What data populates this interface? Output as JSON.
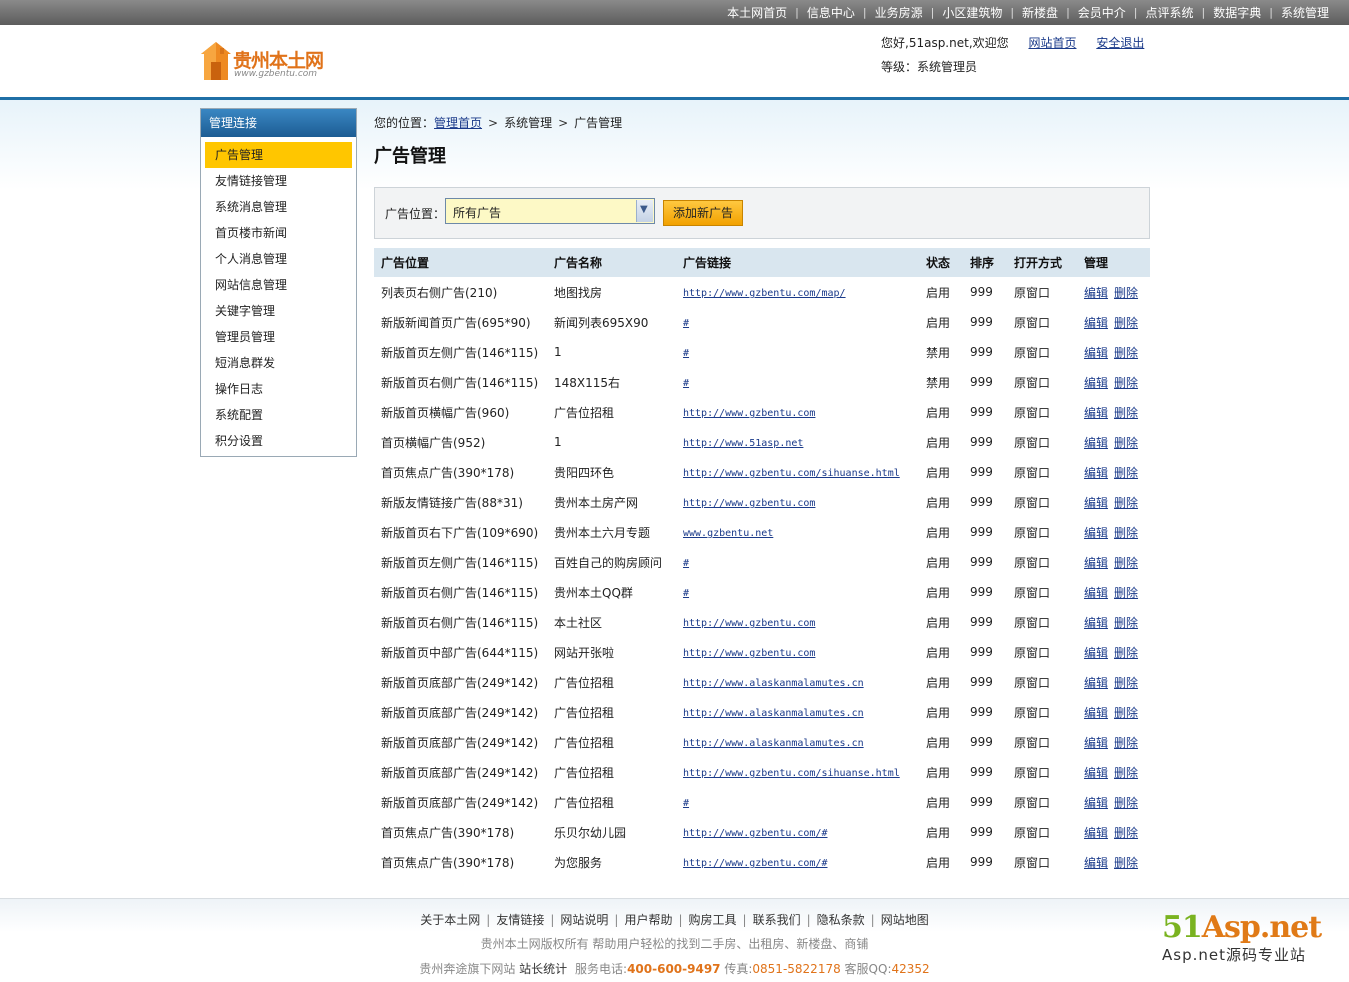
{
  "topnav": [
    "本土网首页",
    "信息中心",
    "业务房源",
    "小区建筑物",
    "新楼盘",
    "会员中介",
    "点评系统",
    "数据字典",
    "系统管理"
  ],
  "logo": {
    "name": "贵州本土网",
    "sub": "www.gzbentu.com"
  },
  "user": {
    "greeting": "您好,51asp.net,欢迎您",
    "home_link": "网站首页",
    "logout_link": "安全退出",
    "level": "等级：系统管理员"
  },
  "sidebar": {
    "title": "管理连接",
    "items": [
      "广告管理",
      "友情链接管理",
      "系统消息管理",
      "首页楼市新闻",
      "个人消息管理",
      "网站信息管理",
      "关键字管理",
      "管理员管理",
      "短消息群发",
      "操作日志",
      "系统配置",
      "积分设置"
    ]
  },
  "breadcrumb": {
    "prefix": "您的位置：",
    "home": "管理首页",
    "level1": "系统管理",
    "current": "广告管理"
  },
  "page_title": "广告管理",
  "filter": {
    "label": "广告位置：",
    "selected": "所有广告",
    "add_button": "添加新广告"
  },
  "table": {
    "headers": [
      "广告位置",
      "广告名称",
      "广告链接",
      "状态",
      "排序",
      "打开方式",
      "管理"
    ],
    "edit_label": "编辑",
    "delete_label": "删除",
    "rows": [
      {
        "pos": "列表页右侧广告(210)",
        "name": "地图找房",
        "link": "http://www.gzbentu.com/map/",
        "status": "启用",
        "order": "999",
        "open": "原窗口"
      },
      {
        "pos": "新版新闻首页广告(695*90)",
        "name": "新闻列表695X90",
        "link": "#",
        "status": "启用",
        "order": "999",
        "open": "原窗口"
      },
      {
        "pos": "新版首页左侧广告(146*115)",
        "name": "1",
        "link": "#",
        "status": "禁用",
        "order": "999",
        "open": "原窗口"
      },
      {
        "pos": "新版首页右侧广告(146*115)",
        "name": "148X115右",
        "link": "#",
        "status": "禁用",
        "order": "999",
        "open": "原窗口"
      },
      {
        "pos": "新版首页横幅广告(960)",
        "name": "广告位招租",
        "link": "http://www.gzbentu.com",
        "status": "启用",
        "order": "999",
        "open": "原窗口"
      },
      {
        "pos": "首页横幅广告(952)",
        "name": "1",
        "link": "http://www.51asp.net",
        "status": "启用",
        "order": "999",
        "open": "原窗口"
      },
      {
        "pos": "首页焦点广告(390*178)",
        "name": "贵阳四环色",
        "link": "http://www.gzbentu.com/sihuanse.html",
        "status": "启用",
        "order": "999",
        "open": "原窗口"
      },
      {
        "pos": "新版友情链接广告(88*31)",
        "name": "贵州本土房产网",
        "link": "http://www.gzbentu.com",
        "status": "启用",
        "order": "999",
        "open": "原窗口"
      },
      {
        "pos": "新版首页右下广告(109*690)",
        "name": "贵州本土六月专题",
        "link": "www.gzbentu.net",
        "status": "启用",
        "order": "999",
        "open": "原窗口"
      },
      {
        "pos": "新版首页左侧广告(146*115)",
        "name": "百姓自己的购房顾问",
        "link": "#",
        "status": "启用",
        "order": "999",
        "open": "原窗口"
      },
      {
        "pos": "新版首页右侧广告(146*115)",
        "name": "贵州本土QQ群",
        "link": "#",
        "status": "启用",
        "order": "999",
        "open": "原窗口"
      },
      {
        "pos": "新版首页右侧广告(146*115)",
        "name": "本土社区",
        "link": "http://www.gzbentu.com",
        "status": "启用",
        "order": "999",
        "open": "原窗口"
      },
      {
        "pos": "新版首页中部广告(644*115)",
        "name": "网站开张啦",
        "link": "http://www.gzbentu.com",
        "status": "启用",
        "order": "999",
        "open": "原窗口"
      },
      {
        "pos": "新版首页底部广告(249*142)",
        "name": "广告位招租",
        "link": "http://www.alaskanmalamutes.cn",
        "status": "启用",
        "order": "999",
        "open": "原窗口"
      },
      {
        "pos": "新版首页底部广告(249*142)",
        "name": "广告位招租",
        "link": "http://www.alaskanmalamutes.cn",
        "status": "启用",
        "order": "999",
        "open": "原窗口"
      },
      {
        "pos": "新版首页底部广告(249*142)",
        "name": "广告位招租",
        "link": "http://www.alaskanmalamutes.cn",
        "status": "启用",
        "order": "999",
        "open": "原窗口"
      },
      {
        "pos": "新版首页底部广告(249*142)",
        "name": "广告位招租",
        "link": "http://www.gzbentu.com/sihuanse.html",
        "status": "启用",
        "order": "999",
        "open": "原窗口"
      },
      {
        "pos": "新版首页底部广告(249*142)",
        "name": "广告位招租",
        "link": "#",
        "status": "启用",
        "order": "999",
        "open": "原窗口"
      },
      {
        "pos": "首页焦点广告(390*178)",
        "name": "乐贝尔幼儿园",
        "link": "http://www.gzbentu.com/#",
        "status": "启用",
        "order": "999",
        "open": "原窗口"
      },
      {
        "pos": "首页焦点广告(390*178)",
        "name": "为您服务",
        "link": "http://www.gzbentu.com/#",
        "status": "启用",
        "order": "999",
        "open": "原窗口"
      }
    ]
  },
  "footer": {
    "links": [
      "关于本土网",
      "友情链接",
      "网站说明",
      "用户帮助",
      "购房工具",
      "联系我们",
      "隐私条款",
      "网站地图"
    ],
    "copyright": "贵州本土网版权所有  帮助用户轻松的找到二手房、出租房、新楼盘、商铺",
    "contact_prefix": "贵州奔途旗下网站",
    "stats_link": "站长统计",
    "phone_label": "服务电话:",
    "phone": "400-600-9497",
    "fax_label": "传真:",
    "fax": "0851-5822178",
    "qq_label": "客服QQ:",
    "qq": "42352"
  },
  "watermark": {
    "main_a": "51",
    "main_b": "Asp.net",
    "sub": "Asp.net源码专业站"
  },
  "colors": {
    "accent": "#ffc600",
    "brand": "#e0731a",
    "header_blue": "#1f6fa6"
  }
}
